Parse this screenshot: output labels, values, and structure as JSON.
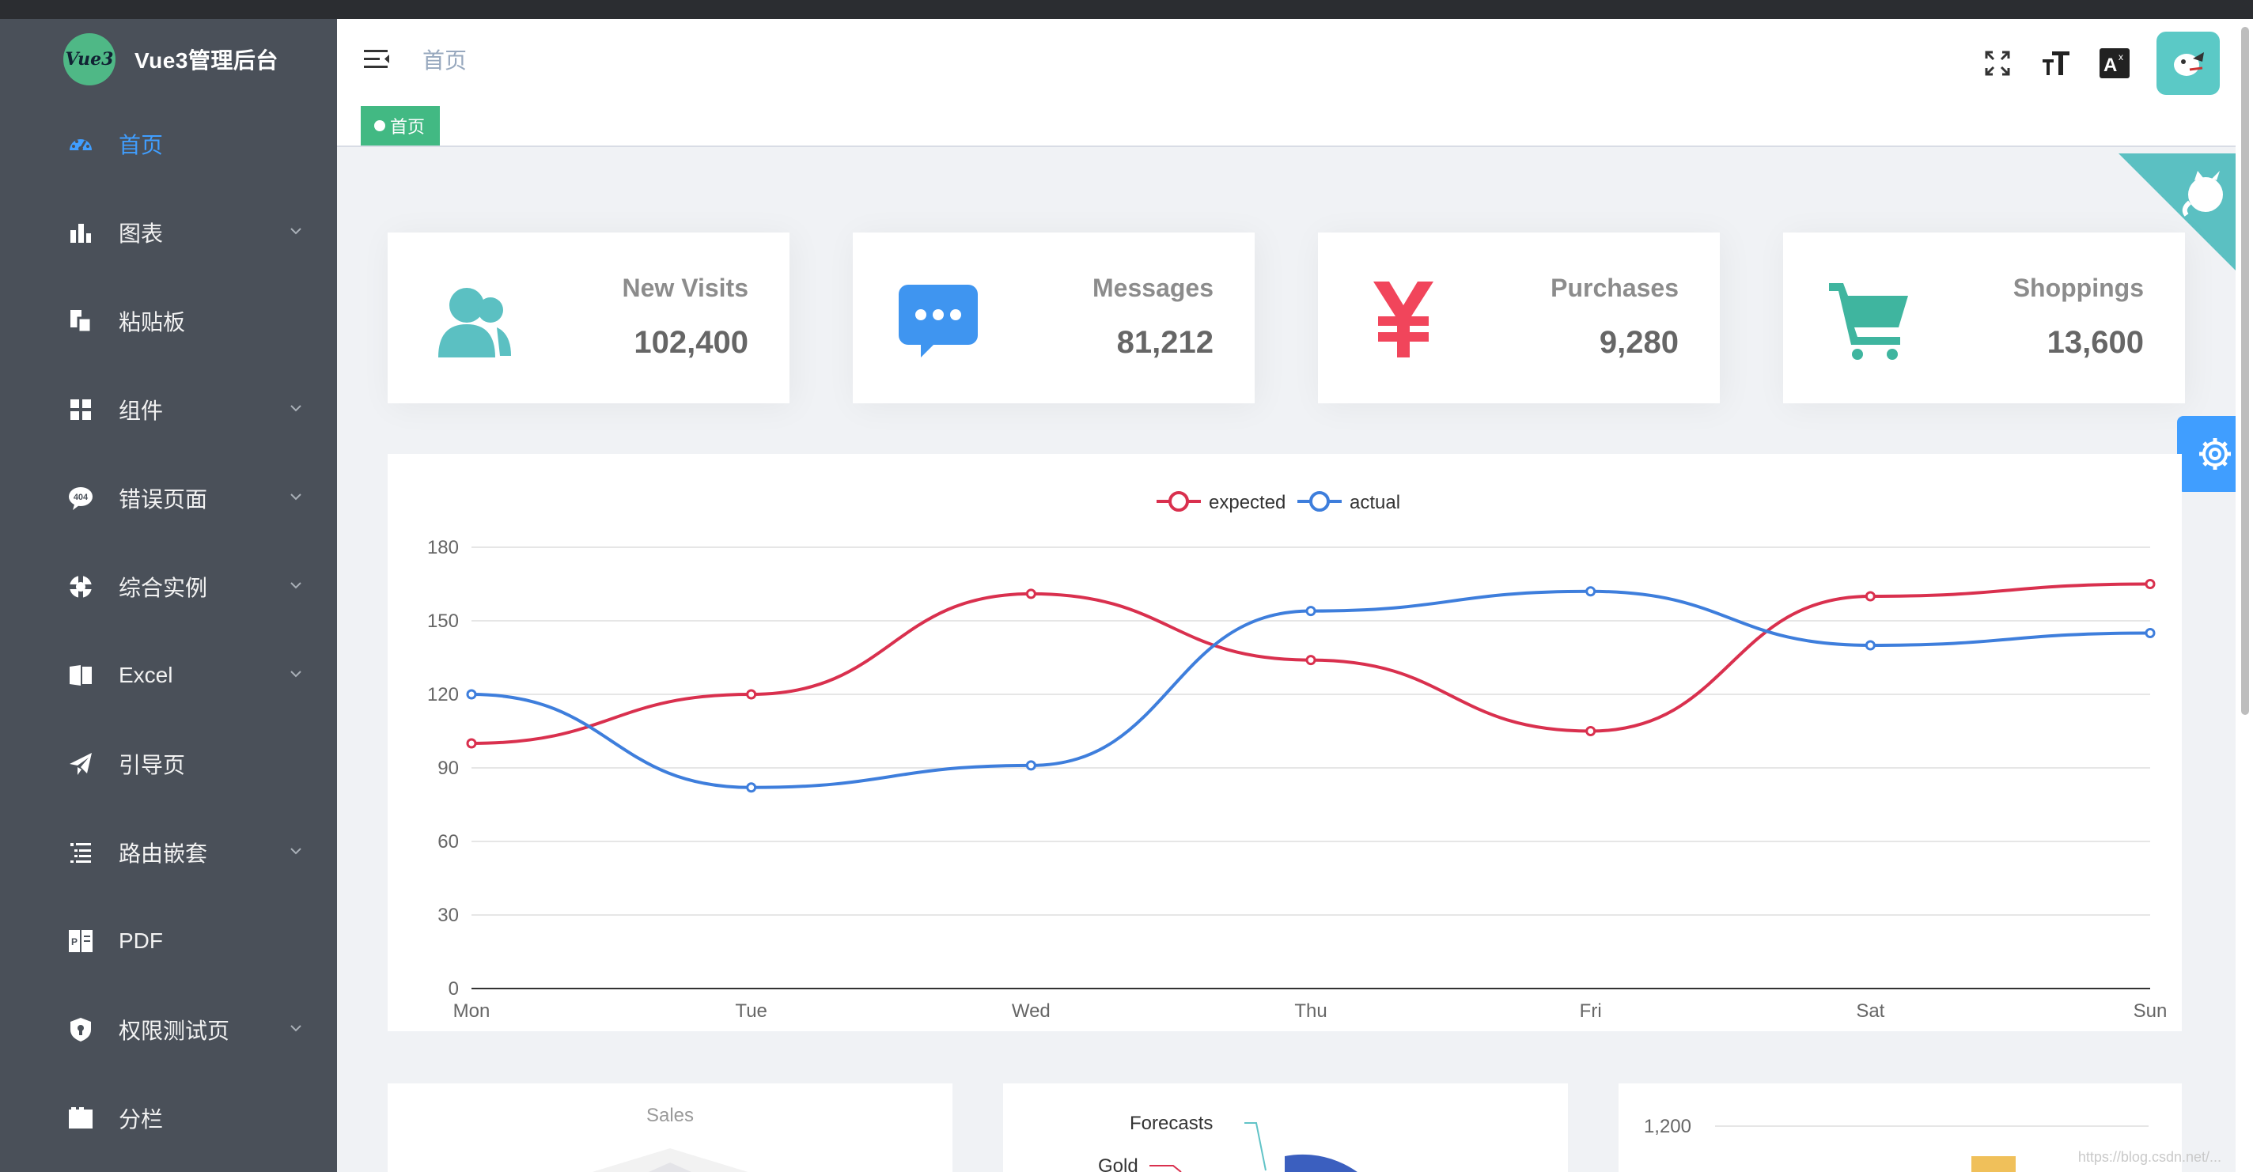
{
  "app": {
    "title": "Vue3管理后台",
    "logo_text": "Vue3"
  },
  "sidebar": {
    "items": [
      {
        "label": "首页",
        "icon": "dashboard-icon",
        "active": true,
        "expandable": false
      },
      {
        "label": "图表",
        "icon": "bar-chart-icon",
        "active": false,
        "expandable": true
      },
      {
        "label": "粘贴板",
        "icon": "clipboard-icon",
        "active": false,
        "expandable": false
      },
      {
        "label": "组件",
        "icon": "components-grid-icon",
        "active": false,
        "expandable": true
      },
      {
        "label": "错误页面",
        "icon": "error-404-icon",
        "active": false,
        "expandable": true
      },
      {
        "label": "综合实例",
        "icon": "example-icon",
        "active": false,
        "expandable": true
      },
      {
        "label": "Excel",
        "icon": "excel-icon",
        "active": false,
        "expandable": true
      },
      {
        "label": "引导页",
        "icon": "paper-plane-icon",
        "active": false,
        "expandable": false
      },
      {
        "label": "路由嵌套",
        "icon": "nested-list-icon",
        "active": false,
        "expandable": true
      },
      {
        "label": "PDF",
        "icon": "pdf-icon",
        "active": false,
        "expandable": false
      },
      {
        "label": "权限测试页",
        "icon": "shield-lock-icon",
        "active": false,
        "expandable": true
      },
      {
        "label": "分栏",
        "icon": "tab-icon",
        "active": false,
        "expandable": false
      }
    ]
  },
  "navbar": {
    "breadcrumb": "首页"
  },
  "tags": [
    {
      "label": "首页",
      "active": true
    }
  ],
  "colors": {
    "sidebar_bg": "#4a5059",
    "accent": "#409eff",
    "tag_green": "#42b983",
    "expected": "#d9304e",
    "actual": "#3e7edc"
  },
  "panel_cards": [
    {
      "title": "New Visits",
      "value": "102,400",
      "icon": "people-icon",
      "color": "#5bc0c2"
    },
    {
      "title": "Messages",
      "value": "81,212",
      "icon": "message-icon",
      "color": "#3f95f0"
    },
    {
      "title": "Purchases",
      "value": "9,280",
      "icon": "money-yen-icon",
      "color": "#f1455b"
    },
    {
      "title": "Shoppings",
      "value": "13,600",
      "icon": "shopping-cart-icon",
      "color": "#3fb59f"
    }
  ],
  "chart_data": {
    "type": "line",
    "categories": [
      "Mon",
      "Tue",
      "Wed",
      "Thu",
      "Fri",
      "Sat",
      "Sun"
    ],
    "series": [
      {
        "name": "expected",
        "values": [
          100,
          120,
          161,
          134,
          105,
          160,
          165
        ],
        "color": "#d9304e"
      },
      {
        "name": "actual",
        "values": [
          120,
          82,
          91,
          154,
          162,
          140,
          145
        ],
        "color": "#3e7edc"
      }
    ],
    "y_ticks": [
      "0",
      "30",
      "60",
      "90",
      "120",
      "150",
      "180"
    ],
    "ylim": [
      0,
      180
    ],
    "grid": true,
    "smooth": true,
    "legend": "top-center"
  },
  "bottom_cards": {
    "radar_label": "Sales",
    "pie_labels": [
      "Forecasts",
      "Gold"
    ],
    "bar_tick": "1,200"
  },
  "watermark": "https://blog.csdn.net/..."
}
